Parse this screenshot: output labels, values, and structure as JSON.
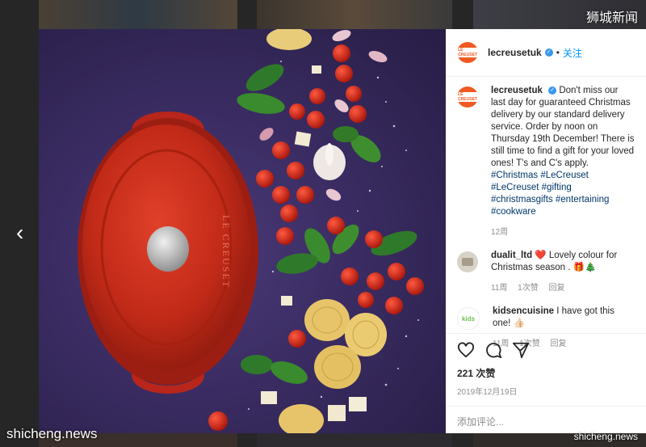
{
  "watermarks": {
    "top_right": "狮城新闻",
    "bottom_left": "shicheng.news",
    "bottom_right": "shicheng.news"
  },
  "post": {
    "username": "lecreusetuk",
    "follow_label": "关注",
    "avatar_text": "LE CREUSET",
    "caption_user": "lecreusetuk",
    "caption_text": "Don't miss our last day for guaranteed Christmas delivery by our standard delivery service. Order by noon on Thursday 19th December! There is still time to find a gift for your loved ones! T's and C's apply.",
    "caption_tags": "#Christmas #LeCreuset #LeCreuset #gifting #christmasgifts #entertaining #cookware",
    "caption_age": "12周",
    "likes": "221 次赞",
    "date": "2019年12月19日",
    "comment_placeholder": "添加评论..."
  },
  "comments": [
    {
      "user": "dualit_ltd",
      "text": "❤️ Lovely colour for Christmas season . 🎁🎄",
      "age": "11周",
      "likes": "1次赞",
      "reply": "回复"
    },
    {
      "user": "kidsencuisine",
      "text": "I have got this one! 👍🏻",
      "age": "11周",
      "likes": "1次赞",
      "reply": "回复"
    }
  ],
  "pot_brand": "LE CREUSET"
}
